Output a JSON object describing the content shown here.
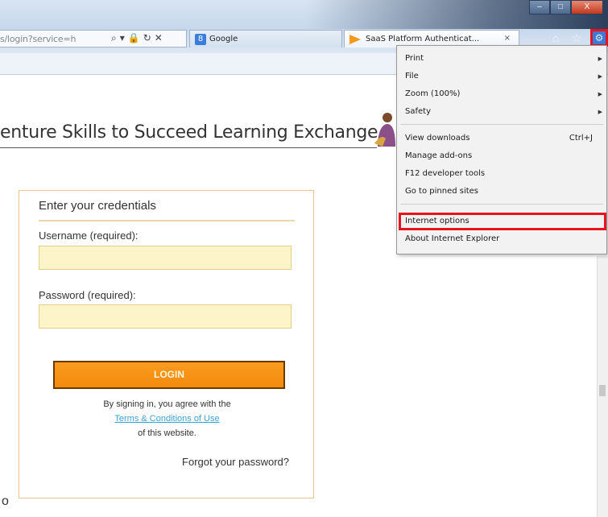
{
  "browser": {
    "address_url": "s/login?service=h",
    "tabs": [
      {
        "label": "Google"
      },
      {
        "label": "SaaS Platform Authenticat...",
        "close": "×"
      }
    ],
    "window_controls": [
      "–",
      "□",
      "X"
    ],
    "icons": [
      "home-icon",
      "favorites-star-icon",
      "tools-gear-icon"
    ],
    "colors": {
      "highlight": "#e8131d",
      "accent": "#f28a0c",
      "link": "#3aa0d6"
    }
  },
  "page": {
    "site_title": "enture Skills to Succeed Learning Exchange",
    "login": {
      "heading": "Enter your credentials",
      "username_label": "Username (required):",
      "password_label": "Password (required):",
      "login_button": "LOGIN",
      "agree_line1": "By signing in, you agree with the",
      "terms_link": "Terms & Conditions of Use",
      "agree_line3": "of this website.",
      "forgot": "Forgot your password?"
    },
    "stray_char": "o"
  },
  "tools_menu": {
    "items": [
      {
        "label": "Print",
        "has_submenu": true
      },
      {
        "label": "File",
        "has_submenu": true
      },
      {
        "label": "Zoom (100%)",
        "has_submenu": true
      },
      {
        "label": "Safety",
        "has_submenu": true
      },
      {
        "label": "View downloads",
        "shortcut": "Ctrl+J"
      },
      {
        "label": "Manage add-ons"
      },
      {
        "label": "F12 developer tools"
      },
      {
        "label": "Go to pinned sites"
      },
      {
        "label": "Internet options",
        "highlighted": true
      },
      {
        "label": "About Internet Explorer"
      }
    ]
  }
}
